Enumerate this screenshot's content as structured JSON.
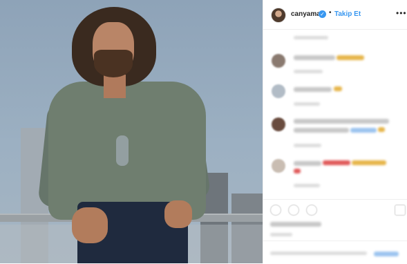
{
  "post": {
    "username": "canyaman",
    "separator": "•",
    "follow_label": "Takip Et",
    "more_glyph": "•••",
    "verified_glyph": "✓"
  },
  "colors": {
    "accent": "#3897f0",
    "text": "#262626",
    "border": "#efefef"
  },
  "icons": [
    "heart-icon",
    "comment-icon",
    "share-icon",
    "bookmark-icon",
    "more-options-icon",
    "verified-badge-icon"
  ]
}
